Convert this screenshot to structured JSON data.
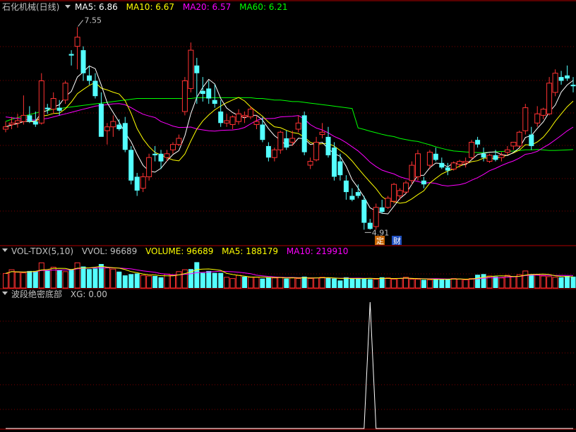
{
  "colors": {
    "bg": "#000000",
    "up": "#ff3232",
    "down": "#54ffff",
    "separator": "#b00000",
    "grid": "#7a0000",
    "white": "#ffffff",
    "yellow": "#ffff00",
    "magenta": "#ff00ff",
    "green": "#00ff00",
    "label": "#c0c0c0",
    "tag_ding_bg": "#c86400",
    "tag_cai_bg": "#2050c0"
  },
  "main_panel": {
    "title": "石化机械(日线)",
    "legend": [
      {
        "label": "MA5: 6.86",
        "color": "#ffffff"
      },
      {
        "label": "MA10: 6.67",
        "color": "#ffff00"
      },
      {
        "label": "MA20: 6.57",
        "color": "#ff00ff"
      },
      {
        "label": "MA60: 6.21",
        "color": "#00ff00"
      }
    ],
    "high_annotation": "7.55",
    "low_annotation": "4.91",
    "tags": [
      "定",
      "财"
    ]
  },
  "vol_panel": {
    "title": "VOL-TDX(5,10)",
    "legend": [
      {
        "label": "VVOL: 96689",
        "color": "#c0c0c0"
      },
      {
        "label": "VOLUME: 96689",
        "color": "#ffff00"
      },
      {
        "label": "MA5: 188179",
        "color": "#ffff00"
      },
      {
        "label": "MA10: 219910",
        "color": "#ff00ff"
      }
    ]
  },
  "ind_panel": {
    "title": "波段绝密底部",
    "legend": [
      {
        "label": "XG: 0.00",
        "color": "#c0c0c0"
      }
    ]
  },
  "chart_data": {
    "type": "candlestick",
    "price_ylim": [
      4.72,
      7.72
    ],
    "volume_ylim": [
      0,
      470000
    ],
    "xg_ylim": [
      0,
      1
    ],
    "ohlc": [
      [
        6.22,
        6.32,
        6.18,
        6.25
      ],
      [
        6.28,
        6.38,
        6.22,
        6.3
      ],
      [
        6.3,
        6.42,
        6.24,
        6.33
      ],
      [
        6.32,
        6.66,
        6.28,
        6.4
      ],
      [
        6.4,
        6.52,
        6.3,
        6.32
      ],
      [
        6.32,
        6.45,
        6.25,
        6.28
      ],
      [
        6.3,
        6.95,
        6.28,
        6.85
      ],
      [
        6.5,
        6.55,
        6.42,
        6.48
      ],
      [
        6.48,
        6.7,
        6.42,
        6.62
      ],
      [
        6.5,
        6.6,
        6.4,
        6.46
      ],
      [
        6.6,
        6.85,
        6.55,
        6.82
      ],
      [
        7.2,
        7.25,
        7.05,
        7.18
      ],
      [
        7.3,
        7.55,
        7.0,
        7.42
      ],
      [
        7.25,
        7.3,
        6.85,
        6.95
      ],
      [
        6.92,
        7.05,
        6.8,
        6.85
      ],
      [
        6.85,
        6.95,
        6.62,
        6.65
      ],
      [
        6.55,
        6.7,
        6.18,
        6.12
      ],
      [
        6.2,
        6.3,
        6.02,
        6.25
      ],
      [
        6.25,
        6.4,
        6.12,
        6.32
      ],
      [
        6.28,
        6.35,
        6.2,
        6.22
      ],
      [
        6.3,
        6.38,
        5.92,
        5.95
      ],
      [
        5.95,
        6.0,
        5.5,
        5.55
      ],
      [
        5.6,
        5.65,
        5.35,
        5.42
      ],
      [
        5.45,
        5.65,
        5.4,
        5.6
      ],
      [
        5.6,
        5.9,
        5.55,
        5.85
      ],
      [
        5.9,
        6.0,
        5.8,
        5.88
      ],
      [
        5.9,
        5.95,
        5.7,
        5.8
      ],
      [
        5.85,
        5.95,
        5.8,
        5.9
      ],
      [
        5.95,
        6.05,
        5.9,
        6.02
      ],
      [
        6.02,
        6.15,
        6.0,
        6.1
      ],
      [
        6.45,
        6.9,
        6.4,
        6.85
      ],
      [
        6.75,
        7.35,
        6.7,
        7.25
      ],
      [
        7.05,
        7.15,
        6.55,
        6.95
      ],
      [
        6.72,
        6.9,
        6.58,
        6.68
      ],
      [
        6.75,
        6.85,
        6.55,
        6.62
      ],
      [
        6.6,
        6.8,
        6.5,
        6.55
      ],
      [
        6.45,
        6.6,
        6.25,
        6.3
      ],
      [
        6.3,
        6.42,
        6.25,
        6.33
      ],
      [
        6.28,
        6.4,
        6.22,
        6.38
      ],
      [
        6.32,
        6.48,
        6.28,
        6.42
      ],
      [
        6.38,
        6.45,
        6.3,
        6.4
      ],
      [
        6.38,
        6.52,
        6.35,
        6.48
      ],
      [
        6.28,
        6.4,
        6.22,
        6.32
      ],
      [
        6.28,
        6.38,
        6.05,
        6.08
      ],
      [
        6.0,
        6.05,
        5.8,
        5.85
      ],
      [
        5.85,
        5.98,
        5.8,
        5.95
      ],
      [
        5.95,
        6.2,
        5.9,
        6.18
      ],
      [
        6.1,
        6.2,
        5.95,
        5.98
      ],
      [
        6.05,
        6.2,
        6.0,
        6.1
      ],
      [
        6.22,
        6.4,
        6.18,
        6.3
      ],
      [
        6.4,
        6.45,
        5.88,
        5.92
      ],
      [
        5.75,
        5.85,
        5.7,
        5.8
      ],
      [
        5.82,
        6.12,
        5.8,
        6.05
      ],
      [
        6.15,
        6.3,
        6.1,
        6.18
      ],
      [
        6.12,
        6.25,
        5.85,
        5.88
      ],
      [
        5.98,
        6.05,
        5.55,
        5.6
      ],
      [
        5.8,
        5.9,
        5.55,
        5.62
      ],
      [
        5.55,
        5.62,
        5.3,
        5.4
      ],
      [
        5.35,
        5.45,
        5.28,
        5.3
      ],
      [
        5.4,
        5.5,
        5.32,
        5.35
      ],
      [
        5.3,
        5.35,
        4.91,
        5.0
      ],
      [
        5.0,
        5.05,
        4.91,
        4.92
      ],
      [
        4.95,
        5.25,
        4.91,
        5.2
      ],
      [
        5.2,
        5.3,
        5.12,
        5.14
      ],
      [
        5.2,
        5.35,
        5.18,
        5.32
      ],
      [
        5.28,
        5.52,
        5.25,
        5.5
      ],
      [
        5.35,
        5.45,
        5.3,
        5.42
      ],
      [
        5.4,
        5.55,
        5.38,
        5.52
      ],
      [
        5.55,
        5.8,
        5.5,
        5.75
      ],
      [
        5.6,
        5.95,
        5.55,
        5.9
      ],
      [
        5.55,
        5.6,
        5.45,
        5.5
      ],
      [
        5.75,
        5.95,
        5.7,
        5.92
      ],
      [
        5.9,
        5.98,
        5.8,
        5.82
      ],
      [
        5.78,
        5.85,
        5.7,
        5.72
      ],
      [
        5.72,
        5.78,
        5.62,
        5.68
      ],
      [
        5.7,
        5.8,
        5.68,
        5.78
      ],
      [
        5.76,
        5.82,
        5.72,
        5.8
      ],
      [
        5.78,
        5.85,
        5.72,
        5.8
      ],
      [
        5.85,
        6.08,
        5.82,
        6.05
      ],
      [
        6.08,
        6.12,
        5.98,
        6.02
      ],
      [
        5.9,
        5.98,
        5.8,
        5.85
      ],
      [
        5.8,
        5.9,
        5.78,
        5.88
      ],
      [
        5.88,
        5.95,
        5.8,
        5.82
      ],
      [
        5.85,
        5.92,
        5.8,
        5.88
      ],
      [
        5.92,
        6.0,
        5.88,
        5.95
      ],
      [
        6.0,
        6.05,
        5.95,
        6.05
      ],
      [
        6.0,
        6.2,
        5.98,
        6.18
      ],
      [
        6.2,
        6.55,
        6.15,
        6.5
      ],
      [
        6.15,
        6.25,
        5.95,
        6.0
      ],
      [
        6.3,
        6.52,
        6.25,
        6.42
      ],
      [
        6.4,
        6.5,
        6.35,
        6.48
      ],
      [
        6.42,
        6.9,
        6.4,
        6.82
      ],
      [
        6.7,
        7.0,
        6.65,
        6.95
      ],
      [
        6.9,
        6.98,
        6.8,
        6.85
      ],
      [
        6.92,
        7.05,
        6.85,
        6.88
      ],
      [
        6.8,
        6.9,
        6.7,
        6.78
      ]
    ],
    "volume": [
      230000,
      290000,
      250000,
      240000,
      270000,
      270000,
      400000,
      280000,
      330000,
      280000,
      260000,
      300000,
      400000,
      340000,
      300000,
      310000,
      380000,
      320000,
      300000,
      260000,
      200000,
      220000,
      230000,
      200000,
      190000,
      190000,
      170000,
      220000,
      200000,
      260000,
      290000,
      300000,
      410000,
      240000,
      270000,
      240000,
      240000,
      170000,
      150000,
      200000,
      180000,
      170000,
      170000,
      150000,
      170000,
      160000,
      170000,
      150000,
      160000,
      150000,
      180000,
      150000,
      160000,
      170000,
      160000,
      150000,
      120000,
      170000,
      150000,
      160000,
      150000,
      140000,
      140000,
      170000,
      160000,
      140000,
      150000,
      170000,
      140000,
      140000,
      130000,
      130000,
      150000,
      140000,
      140000,
      150000,
      140000,
      130000,
      150000,
      210000,
      220000,
      190000,
      180000,
      160000,
      200000,
      180000,
      210000,
      270000,
      220000,
      210000,
      190000,
      180000,
      170000,
      170000,
      190000,
      180000
    ],
    "volume_colors": [
      "up",
      "up",
      "up",
      "up",
      "down",
      "down",
      "up",
      "down",
      "up",
      "down",
      "up",
      "down",
      "up",
      "down",
      "down",
      "down",
      "down",
      "up",
      "up",
      "down",
      "down",
      "down",
      "down",
      "up",
      "up",
      "down",
      "down",
      "up",
      "up",
      "up",
      "up",
      "down",
      "down",
      "down",
      "down",
      "down",
      "down",
      "up",
      "up",
      "up",
      "down",
      "up",
      "up",
      "down",
      "down",
      "up",
      "up",
      "down",
      "up",
      "up",
      "down",
      "up",
      "up",
      "up",
      "down",
      "down",
      "down",
      "down",
      "down",
      "down",
      "down",
      "down",
      "up",
      "down",
      "up",
      "up",
      "up",
      "up",
      "up",
      "up",
      "down",
      "up",
      "down",
      "down",
      "down",
      "up",
      "up",
      "up",
      "up",
      "down",
      "down",
      "up",
      "down",
      "up",
      "up",
      "up",
      "up",
      "up",
      "down",
      "up",
      "up",
      "up",
      "up",
      "down",
      "down",
      "down"
    ],
    "xg": [
      0,
      0,
      0,
      0,
      0,
      0,
      0,
      0,
      0,
      0,
      0,
      0,
      0,
      0,
      0,
      0,
      0,
      0,
      0,
      0,
      0,
      0,
      0,
      0,
      0,
      0,
      0,
      0,
      0,
      0,
      0,
      0,
      0,
      0,
      0,
      0,
      0,
      0,
      0,
      0,
      0,
      0,
      0,
      0,
      0,
      0,
      0,
      0,
      0,
      0,
      0,
      0,
      0,
      0,
      0,
      0,
      0,
      0,
      0,
      0,
      0,
      1,
      0,
      0,
      0,
      0,
      0,
      0,
      0,
      0,
      0,
      0,
      0,
      0,
      0,
      0,
      0,
      0,
      0,
      0,
      0,
      0,
      0,
      0,
      0,
      0,
      0,
      0,
      0,
      0,
      0,
      0,
      0,
      0,
      0,
      0
    ],
    "ma20_start": [
      6.38,
      6.37,
      6.36,
      6.35,
      6.34,
      6.34,
      6.35,
      6.36,
      6.38,
      6.4,
      6.42,
      6.44,
      6.46,
      6.48,
      6.5,
      6.52,
      6.53,
      6.54,
      6.55
    ],
    "ma60_start": [
      6.32,
      6.35,
      6.37,
      6.39,
      6.41,
      6.43,
      6.45,
      6.46,
      6.48,
      6.49,
      6.5,
      6.51,
      6.52,
      6.53,
      6.54,
      6.55,
      6.56,
      6.57,
      6.58,
      6.59,
      6.6,
      6.61,
      6.62,
      6.62,
      6.62,
      6.62,
      6.62,
      6.62,
      6.62,
      6.62,
      6.62,
      6.62,
      6.63,
      6.63,
      6.63,
      6.63,
      6.63,
      6.63,
      6.63,
      6.63,
      6.63,
      6.63,
      6.62,
      6.62,
      6.61,
      6.6,
      6.6,
      6.59,
      6.58,
      6.58,
      6.57,
      6.56,
      6.55,
      6.54,
      6.53,
      6.52,
      6.51,
      6.5,
      6.49
    ]
  }
}
